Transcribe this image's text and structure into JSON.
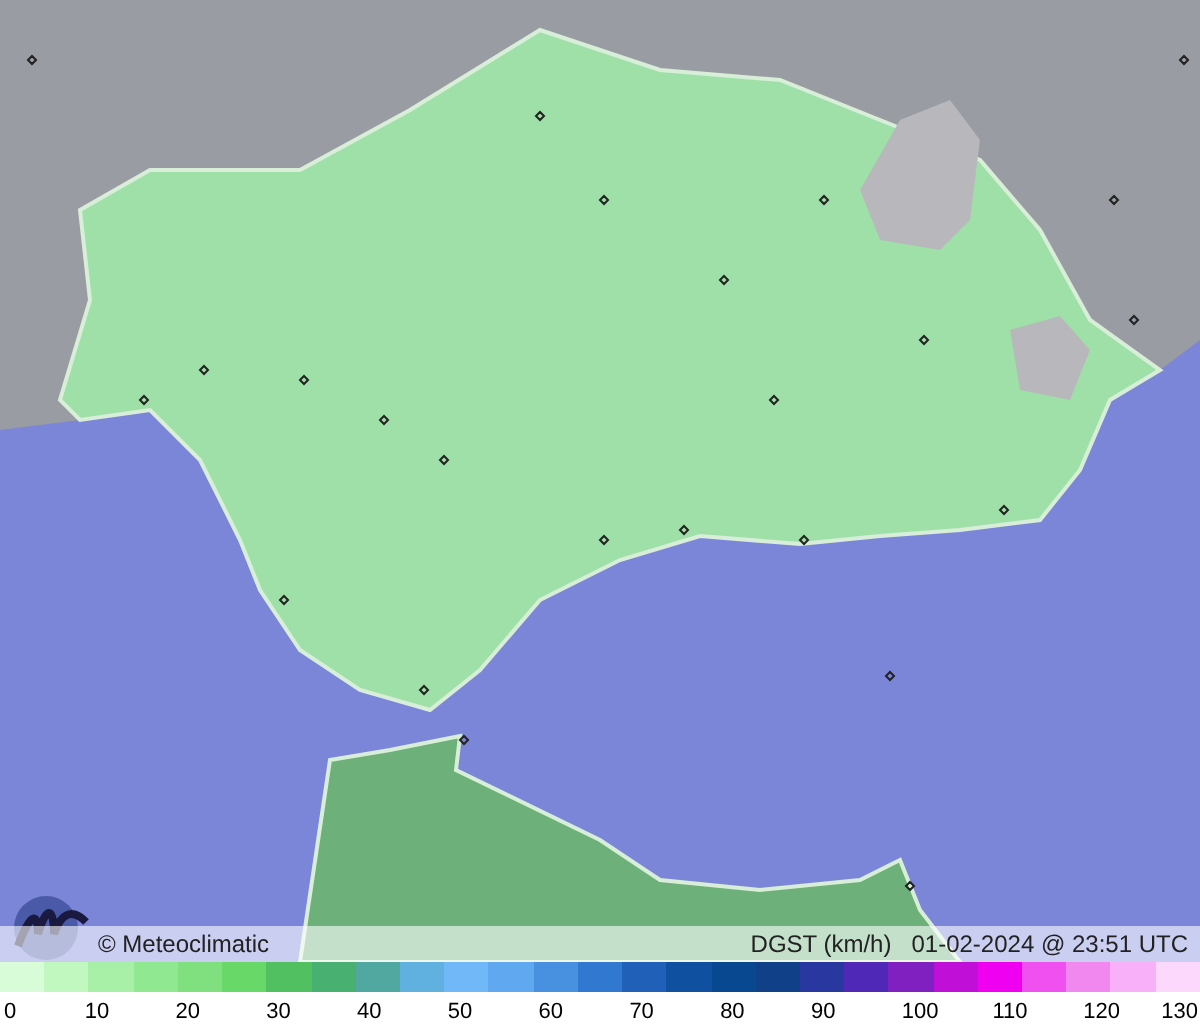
{
  "caption": {
    "copyright": "© Meteoclimatic",
    "variable": "DGST (km/h)",
    "timestamp": "01-02-2024 @ 23:51 UTC"
  },
  "legend": {
    "swatches": [
      {
        "color": "#d8fcd8"
      },
      {
        "color": "#c0f8c0"
      },
      {
        "color": "#a8f0a8"
      },
      {
        "color": "#90e890"
      },
      {
        "color": "#80e080"
      },
      {
        "color": "#68d868"
      },
      {
        "color": "#50c060"
      },
      {
        "color": "#48b070"
      },
      {
        "color": "#50a8a0"
      },
      {
        "color": "#60b0e0"
      },
      {
        "color": "#70b8f8"
      },
      {
        "color": "#60a8f0"
      },
      {
        "color": "#4890e0"
      },
      {
        "color": "#3078d0"
      },
      {
        "color": "#2060b8"
      },
      {
        "color": "#1050a0"
      },
      {
        "color": "#084890"
      },
      {
        "color": "#104088"
      },
      {
        "color": "#2838a0"
      },
      {
        "color": "#5028b8"
      },
      {
        "color": "#8020c0"
      },
      {
        "color": "#c010d8"
      },
      {
        "color": "#f000f0"
      },
      {
        "color": "#f050f0"
      },
      {
        "color": "#f088f0"
      },
      {
        "color": "#f8b0f8"
      },
      {
        "color": "#fcd8fc"
      }
    ],
    "ticks": [
      "0",
      "10",
      "20",
      "30",
      "40",
      "50",
      "60",
      "70",
      "80",
      "90",
      "100",
      "110",
      "120",
      "130"
    ]
  }
}
